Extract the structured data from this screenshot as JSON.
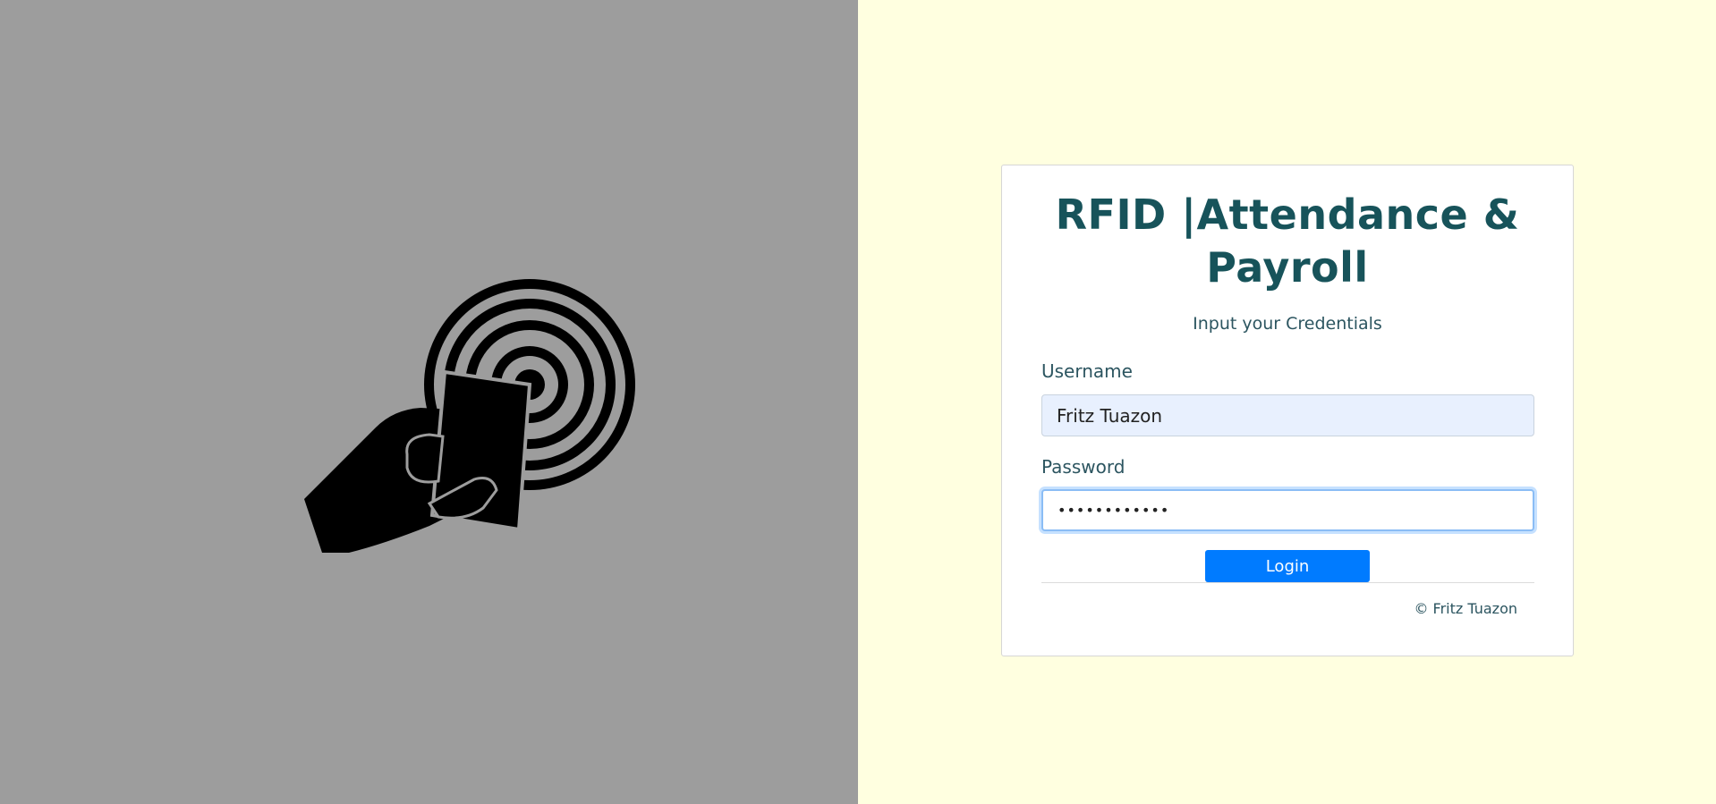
{
  "login": {
    "title": "RFID |Attendance & Payroll",
    "subtitle": "Input your Credentials",
    "username_label": "Username",
    "username_value": "Fritz Tuazon",
    "password_label": "Password",
    "password_value": "••••••••••••",
    "login_button": "Login",
    "copyright": "© Fritz Tuazon"
  },
  "colors": {
    "left_background": "#9d9d9d",
    "right_background": "#ffffe0",
    "title": "#17535a",
    "button": "#007bff"
  },
  "icons": {
    "logo": "rfid-hand-card-icon"
  }
}
